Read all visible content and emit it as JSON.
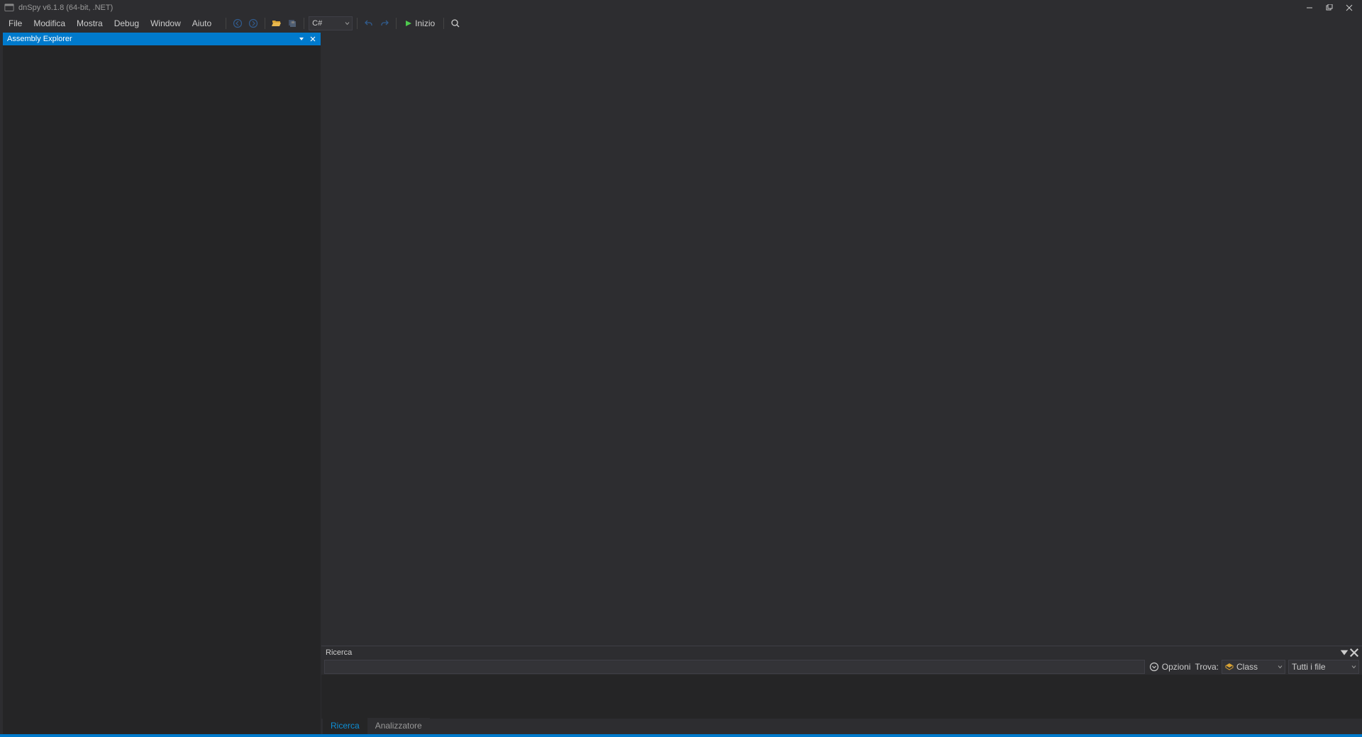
{
  "titlebar": {
    "title": "dnSpy v6.1.8 (64-bit, .NET)"
  },
  "menu": {
    "items": [
      "File",
      "Modifica",
      "Mostra",
      "Debug",
      "Window",
      "Aiuto"
    ]
  },
  "toolbar": {
    "language": "C#",
    "start_label": "Inizio"
  },
  "assembly_explorer": {
    "title": "Assembly Explorer"
  },
  "search_panel": {
    "title": "Ricerca",
    "options_label": "Opzioni",
    "find_label": "Trova:",
    "class_option": "Class",
    "file_option": "Tutti i file",
    "tabs": {
      "search": "Ricerca",
      "analyzer": "Analizzatore"
    }
  }
}
